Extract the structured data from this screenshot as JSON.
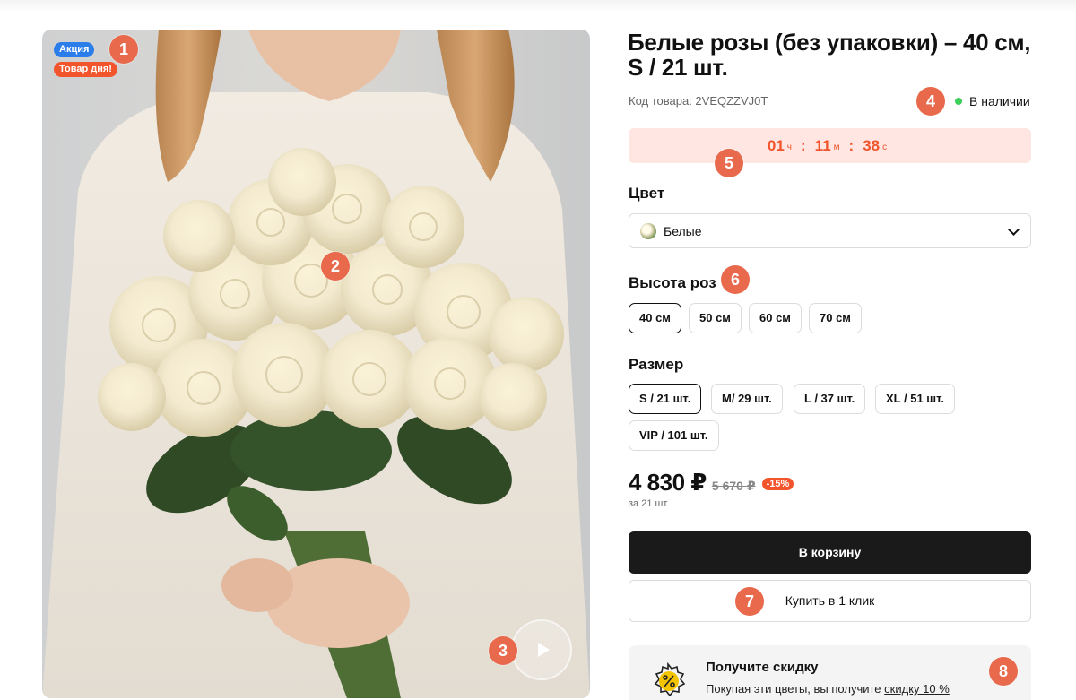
{
  "badges": {
    "sale": "Акция",
    "deal": "Товар дня!"
  },
  "product": {
    "title": "Белые розы (без упаковки) – 40 см, S / 21 шт.",
    "sku_label": "Код товара: 2VEQZZVJ0T",
    "stock": "В наличии",
    "stock_color": "#3ccf5a"
  },
  "timer": {
    "hours": "01",
    "h_unit": "ч",
    "minutes": "11",
    "m_unit": "м",
    "seconds": "38",
    "s_unit": "с",
    "sep": ":"
  },
  "color": {
    "label": "Цвет",
    "selected": "Белые"
  },
  "height": {
    "label": "Высота роз",
    "options": [
      "40 см",
      "50 см",
      "60 см",
      "70 см"
    ],
    "selected": "40 см"
  },
  "size": {
    "label": "Размер",
    "options": [
      "S / 21 шт.",
      "M/ 29 шт.",
      "L / 37 шт.",
      "XL / 51 шт.",
      "VIP / 101 шт."
    ],
    "selected": "S / 21 шт."
  },
  "price": {
    "current": "4 830 ₽",
    "old": "5 670 ₽",
    "discount": "-15%",
    "per": "за 21 шт"
  },
  "buttons": {
    "cart": "В корзину",
    "one_click": "Купить в 1 клик"
  },
  "promo": {
    "title": "Получите скидку",
    "text": "Покупая эти цветы, вы получите ",
    "link": "скидку 10 %"
  },
  "markers": [
    "1",
    "2",
    "3",
    "4",
    "5",
    "6",
    "7",
    "8"
  ],
  "colors": {
    "accent": "#f2552c",
    "sale_badge": "#2b7de9",
    "marker": "#e8694c",
    "cart_button": "#1a1a1a",
    "timer_bg": "#ffe6e2"
  }
}
